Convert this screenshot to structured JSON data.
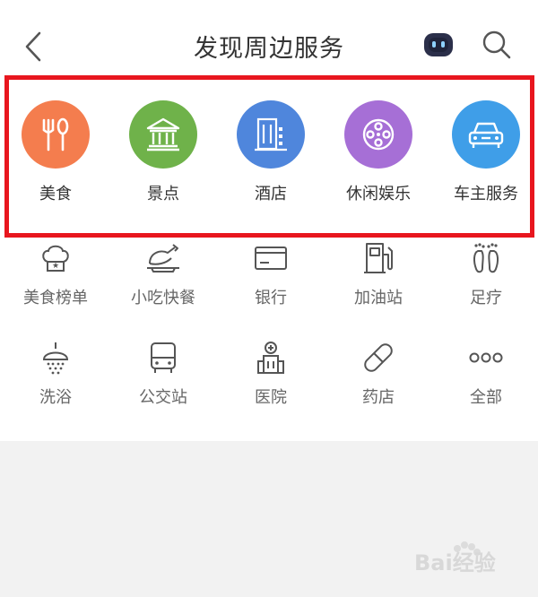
{
  "header": {
    "title": "发现周边服务",
    "icons": [
      "back-arrow-icon",
      "robot-icon",
      "search-icon"
    ]
  },
  "main_categories": [
    {
      "label": "美食",
      "icon": "fork-spoon-icon",
      "color": "#f47d4e"
    },
    {
      "label": "景点",
      "icon": "temple-icon",
      "color": "#6fb24a"
    },
    {
      "label": "酒店",
      "icon": "hotel-building-icon",
      "color": "#4f86dc"
    },
    {
      "label": "休闲娱乐",
      "icon": "film-reel-icon",
      "color": "#a66fd6"
    },
    {
      "label": "车主服务",
      "icon": "car-icon",
      "color": "#3f9ee8"
    }
  ],
  "sub_categories_row1": [
    {
      "label": "美食榜单",
      "icon": "chef-hat-icon"
    },
    {
      "label": "小吃快餐",
      "icon": "roast-chicken-icon"
    },
    {
      "label": "银行",
      "icon": "bank-card-icon"
    },
    {
      "label": "加油站",
      "icon": "fuel-pump-icon"
    },
    {
      "label": "足疗",
      "icon": "footprints-icon"
    }
  ],
  "sub_categories_row2": [
    {
      "label": "洗浴",
      "icon": "shower-icon"
    },
    {
      "label": "公交站",
      "icon": "bus-icon"
    },
    {
      "label": "医院",
      "icon": "hospital-icon"
    },
    {
      "label": "药店",
      "icon": "pill-icon"
    },
    {
      "label": "全部",
      "icon": "more-dots-icon"
    }
  ],
  "watermark": {
    "text": "Bai经验"
  },
  "colors": {
    "highlight_border": "#e8161e",
    "bottom_background": "#f2f2f2"
  }
}
